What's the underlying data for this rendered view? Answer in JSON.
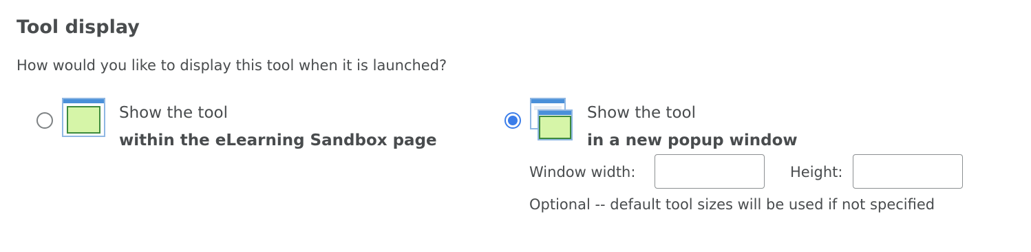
{
  "section": {
    "heading": "Tool display",
    "question": "How would you like to display this tool when it is launched?"
  },
  "options": [
    {
      "line1": "Show the tool",
      "line2": "within the eLearning Sandbox page",
      "selected": false,
      "icon": "embedded-window-icon"
    },
    {
      "line1": "Show the tool",
      "line2": "in a new popup window",
      "selected": true,
      "icon": "popup-window-icon"
    }
  ],
  "popup_settings": {
    "width_label": "Window width:",
    "width_value": "",
    "height_label": "Height:",
    "height_value": "",
    "hint": "Optional -- default tool sizes will be used if not specified"
  },
  "colors": {
    "text": "#494c4e",
    "radio_selected": "#3b7de9",
    "window_frame": "#4a90d9",
    "window_content": "#d6f5a8"
  }
}
